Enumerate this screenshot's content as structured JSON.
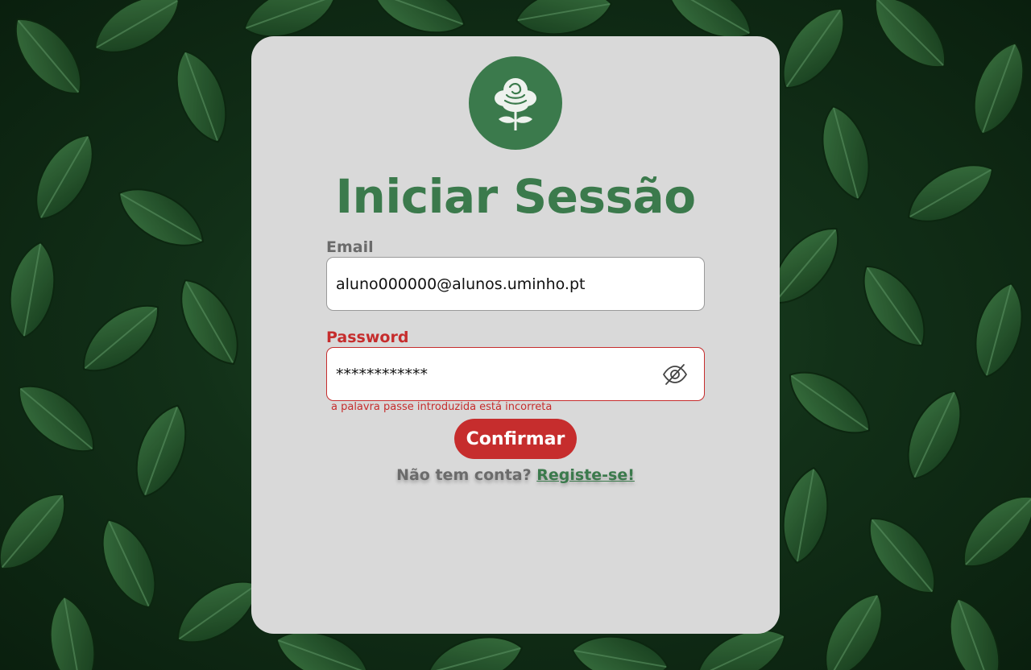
{
  "app": {
    "title": "Iniciar Sessão"
  },
  "form": {
    "email_label": "Email",
    "email_value": "aluno000000@alunos.uminho.pt",
    "password_label": "Password",
    "password_value": "************",
    "password_error": "a palavra passe introduzida está incorreta",
    "submit_label": "Confirmar"
  },
  "register": {
    "question": "Não tem conta?",
    "link_label": "Registe-se!"
  },
  "icons": {
    "logo": "rose-logo-icon",
    "toggle_password": "eye-off-icon"
  },
  "colors": {
    "brand_green": "#3b7a4c",
    "error_red": "#c62d2d",
    "card_bg": "#d9d9d9"
  }
}
